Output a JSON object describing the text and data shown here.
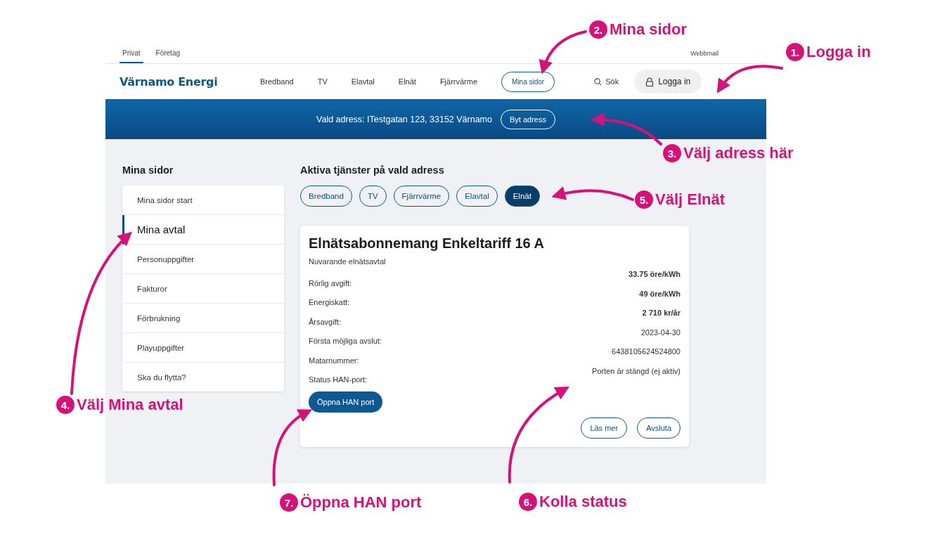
{
  "top_tabs": [
    {
      "label": "Privat",
      "selected": true
    },
    {
      "label": "Företag",
      "selected": false
    }
  ],
  "webmail_link": "Webbmail",
  "logo": "Värnamo Energi",
  "nav": [
    {
      "label": "Bredband",
      "kind": "link"
    },
    {
      "label": "TV",
      "kind": "link"
    },
    {
      "label": "Elavtal",
      "kind": "link"
    },
    {
      "label": "Elnät",
      "kind": "link"
    },
    {
      "label": "Fjärrvärme",
      "kind": "link"
    },
    {
      "label": "Mina sidor",
      "kind": "pill"
    }
  ],
  "search": "Sök",
  "login": "Logga in",
  "address_bar": {
    "label": "Vald adress:",
    "value": "ITestgatan 123, 33152 Värnamo",
    "button": "Byt adress"
  },
  "sidebar": {
    "title": "Mina sidor",
    "items": [
      {
        "label": "Mina sidor start",
        "selected": false
      },
      {
        "label": "Mina avtal",
        "selected": true
      },
      {
        "label": "Personuppgifter",
        "selected": false
      },
      {
        "label": "Fakturor",
        "selected": false
      },
      {
        "label": "Förbrukning",
        "selected": false
      },
      {
        "label": "Playuppgifter",
        "selected": false
      },
      {
        "label": "Ska du flytta?",
        "selected": false
      }
    ]
  },
  "services": {
    "title": "Aktiva tjänster på vald adress",
    "chips": [
      {
        "label": "Bredband",
        "selected": false
      },
      {
        "label": "TV",
        "selected": false
      },
      {
        "label": "Fjärrvärme",
        "selected": false
      },
      {
        "label": "Elavtal",
        "selected": false
      },
      {
        "label": "Elnät",
        "selected": true
      }
    ]
  },
  "contract": {
    "title": "Elnätsabonnemang Enkeltariff 16 A",
    "subtitle": "Nuvarande elnätsavtal",
    "rows": [
      {
        "label": "Rörlig avgift:",
        "value": "33.75 öre/kWh",
        "bold": true
      },
      {
        "label": "Energiskatt:",
        "value": "49 öre/kWh",
        "bold": true
      },
      {
        "label": "Årsavgift:",
        "value": "2 710 kr/år",
        "bold": true
      },
      {
        "label": "Första möjliga avslut:",
        "value": "2023-04-30",
        "bold": false
      },
      {
        "label": "Matarnummer:",
        "value": "6438105624524800",
        "bold": false
      },
      {
        "label": "Status HAN-port:",
        "value": "Porten är stängd (ej aktiv)",
        "bold": false
      }
    ],
    "primary_button": "Öppna HAN port",
    "buttons": [
      "Läs mer",
      "Avsluta"
    ]
  },
  "annotations": [
    {
      "number": "2.",
      "label": "Mina sidor"
    },
    {
      "number": "1.",
      "label": "Logga in"
    },
    {
      "number": "3.",
      "label": "Välj adress här"
    },
    {
      "number": "5.",
      "label": "Välj Elnät"
    },
    {
      "number": "4.",
      "label": "Välj Mina avtal"
    },
    {
      "number": "7.",
      "label": "Öppna HAN port"
    },
    {
      "number": "6.",
      "label": "Kolla status"
    }
  ]
}
